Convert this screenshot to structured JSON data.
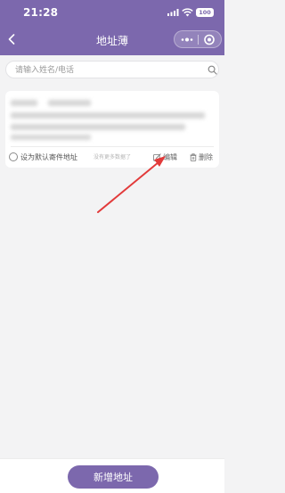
{
  "status_bar": {
    "time": "21:28",
    "battery": "100"
  },
  "nav": {
    "title": "地址薄"
  },
  "search": {
    "placeholder": "请输入姓名/电话"
  },
  "address_card": {
    "default_label": "设为默认寄件地址",
    "edit_label": "编辑",
    "delete_label": "删除"
  },
  "list_footer": "没有更多数据了",
  "bottom": {
    "add_label": "新增地址"
  },
  "colors": {
    "brand": "#7c68ad",
    "background": "#f3f3f4",
    "annotation": "#e23a3a"
  },
  "icons": [
    "back-icon",
    "more-icon",
    "close-icon",
    "search-icon",
    "edit-icon",
    "trash-icon",
    "signal-icon",
    "wifi-icon"
  ]
}
